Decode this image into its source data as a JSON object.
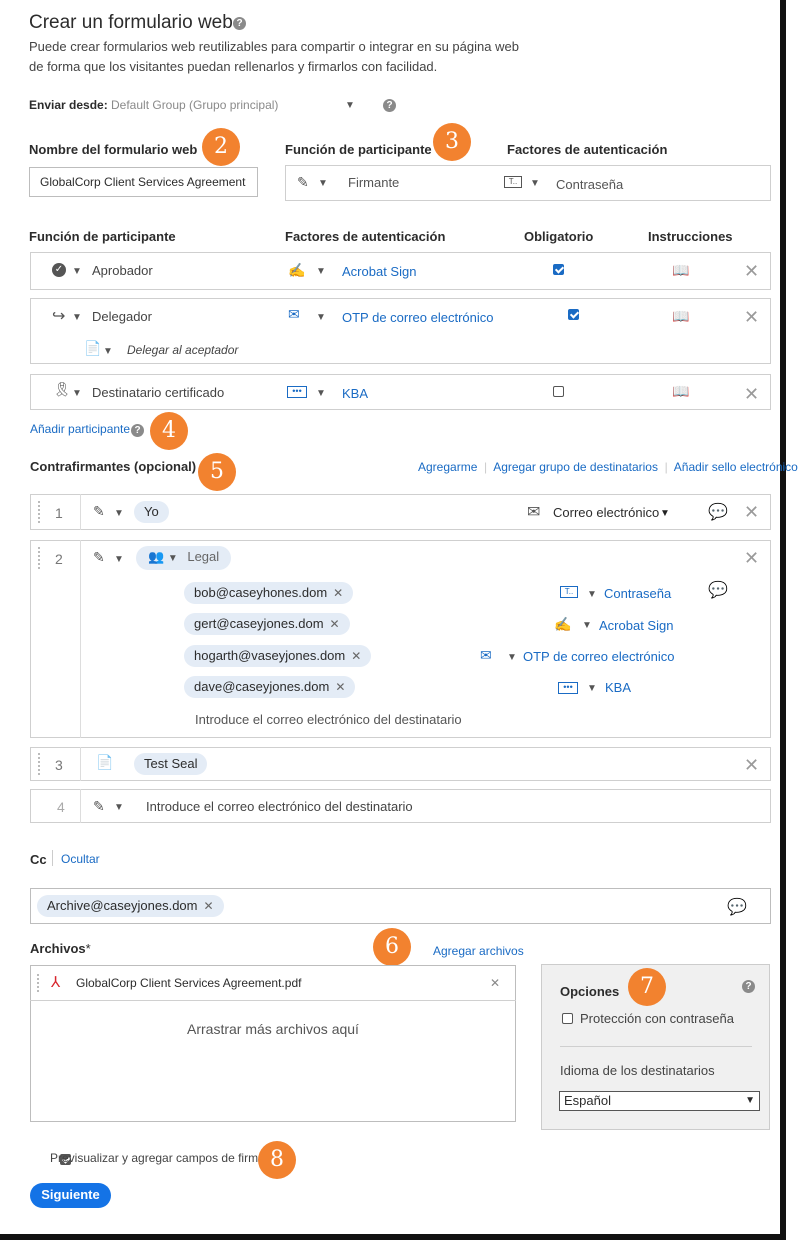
{
  "header": {
    "title": "Crear un formulario web",
    "description_line1": "Puede crear formularios web reutilizables para compartir o integrar en su página web",
    "description_line2": "de forma que los visitantes puedan rellenarlos y firmarlos con facilidad."
  },
  "send_from": {
    "label": "Enviar desde:",
    "value": "Default Group (Grupo principal)"
  },
  "badges": [
    "2",
    "3",
    "4",
    "5",
    "6",
    "7",
    "8"
  ],
  "form_name": {
    "label": "Nombre del formulario web",
    "value": "GlobalCorp Client Services Agreement"
  },
  "signer_box": {
    "role_label": "Función de participante",
    "auth_label": "Factores de autenticación",
    "role_value": "Firmante",
    "auth_value": "Contraseña"
  },
  "participants": {
    "headers": {
      "role": "Función de participante",
      "auth": "Factores de autenticación",
      "required": "Obligatorio",
      "instructions": "Instrucciones"
    },
    "rows": [
      {
        "role": "Aprobador",
        "auth": "Acrobat Sign",
        "required": true
      },
      {
        "role": "Delegador",
        "auth": "OTP de correo electrónico",
        "required": true,
        "sub": "Delegar al aceptador"
      },
      {
        "role": "Destinatario certificado",
        "auth": "KBA",
        "required": false
      }
    ],
    "add_label": "Añadir participante"
  },
  "countersigners": {
    "label": "Contrafirmantes (opcional)",
    "actions": [
      "Agregarme",
      "Agregar grupo de destinatarios",
      "Añadir sello electrónico"
    ],
    "rows": [
      {
        "num": "1",
        "chip": "Yo",
        "delivery": "Correo electrónico"
      },
      {
        "num": "2",
        "group": "Legal",
        "members": [
          {
            "email": "bob@caseyhones.dom",
            "auth": "Contraseña"
          },
          {
            "email": "gert@caseyjones.dom",
            "auth": "Acrobat Sign"
          },
          {
            "email": "hogarth@vaseyjones.dom",
            "auth": "OTP de correo electrónico"
          },
          {
            "email": "dave@caseyjones.dom",
            "auth": "KBA"
          }
        ],
        "placeholder": "Introduce el correo electrónico del destinatario"
      },
      {
        "num": "3",
        "chip": "Test Seal"
      },
      {
        "num": "4",
        "placeholder": "Introduce el correo electrónico del destinatario"
      }
    ]
  },
  "cc": {
    "label": "Cc",
    "hide": "Ocultar",
    "chip": "Archive@caseyjones.dom"
  },
  "files": {
    "label": "Archivos",
    "required_mark": "*",
    "add_label": "Agregar archivos",
    "file_name": "GlobalCorp Client Services Agreement.pdf",
    "drop_text": "Arrastrar más archivos aquí"
  },
  "options": {
    "title": "Opciones",
    "password_label": "Protección con contraseña",
    "language_label": "Idioma de los destinatarios",
    "language_value": "Español"
  },
  "footer": {
    "preview_label": "Previsualizar y agregar campos de firma",
    "next_label": "Siguiente"
  },
  "colors": {
    "accent": "#1473e6",
    "badge": "#f2822f",
    "link": "#1a6bc4"
  }
}
